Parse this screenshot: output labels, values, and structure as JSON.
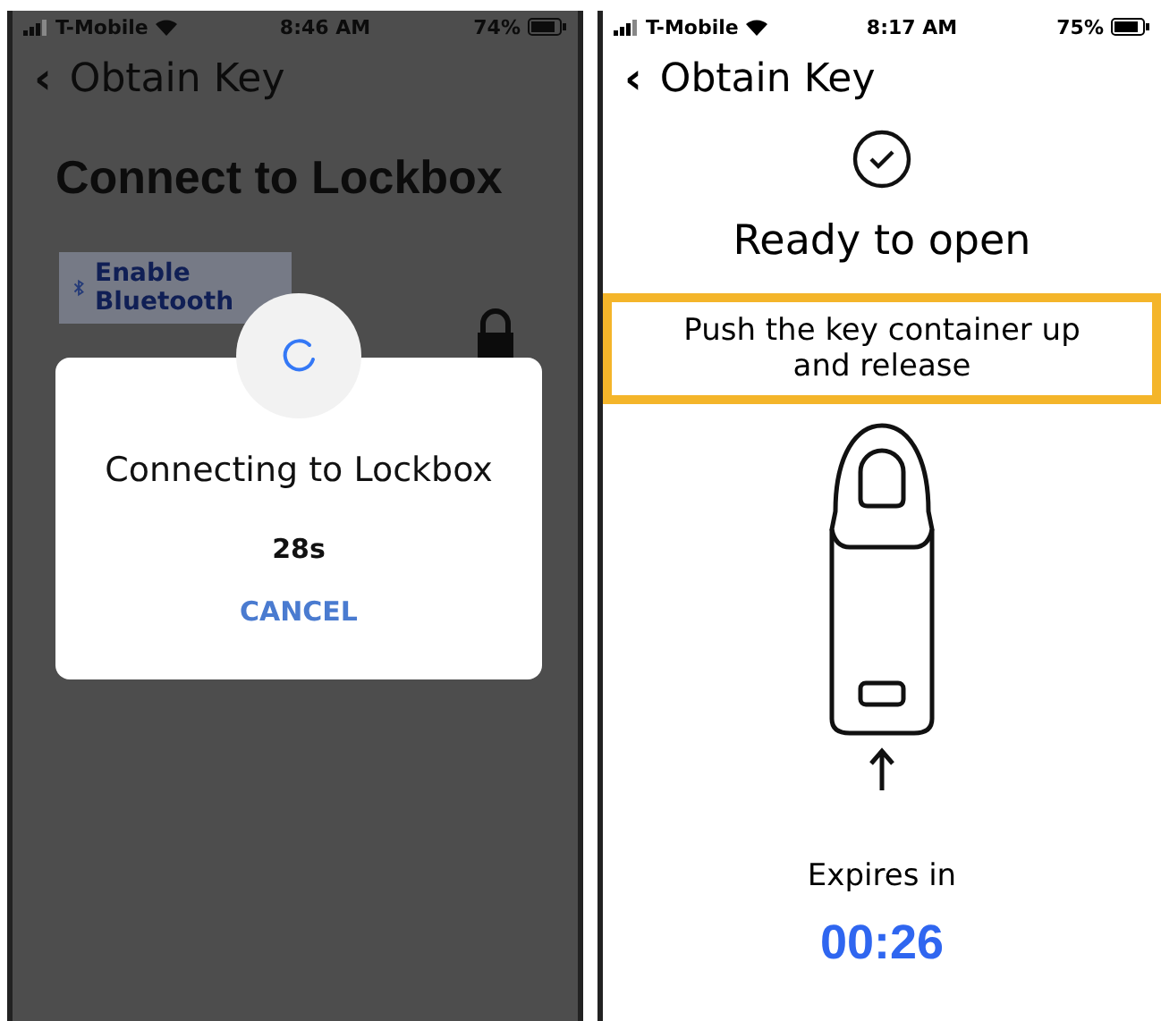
{
  "connect_screen": {
    "status_bar": {
      "carrier": "T-Mobile",
      "time": "8:46 AM",
      "battery": "74%"
    },
    "nav": {
      "back": "‹",
      "title": "Obtain Key"
    },
    "heading": "Connect to Lockbox",
    "bluetooth_button": "Enable Bluetooth",
    "dialog": {
      "message": "Connecting to Lockbox",
      "countdown": "28s",
      "cancel": "CANCEL"
    }
  },
  "open_screen": {
    "status_bar": {
      "carrier": "T-Mobile",
      "time": "8:17 AM",
      "battery": "75%"
    },
    "nav": {
      "back": "‹",
      "title": "Obtain Key"
    },
    "status": "Ready to open",
    "instruction": "Push the key container up and release",
    "expires_label": "Expires in",
    "expires_time": "00:26"
  }
}
